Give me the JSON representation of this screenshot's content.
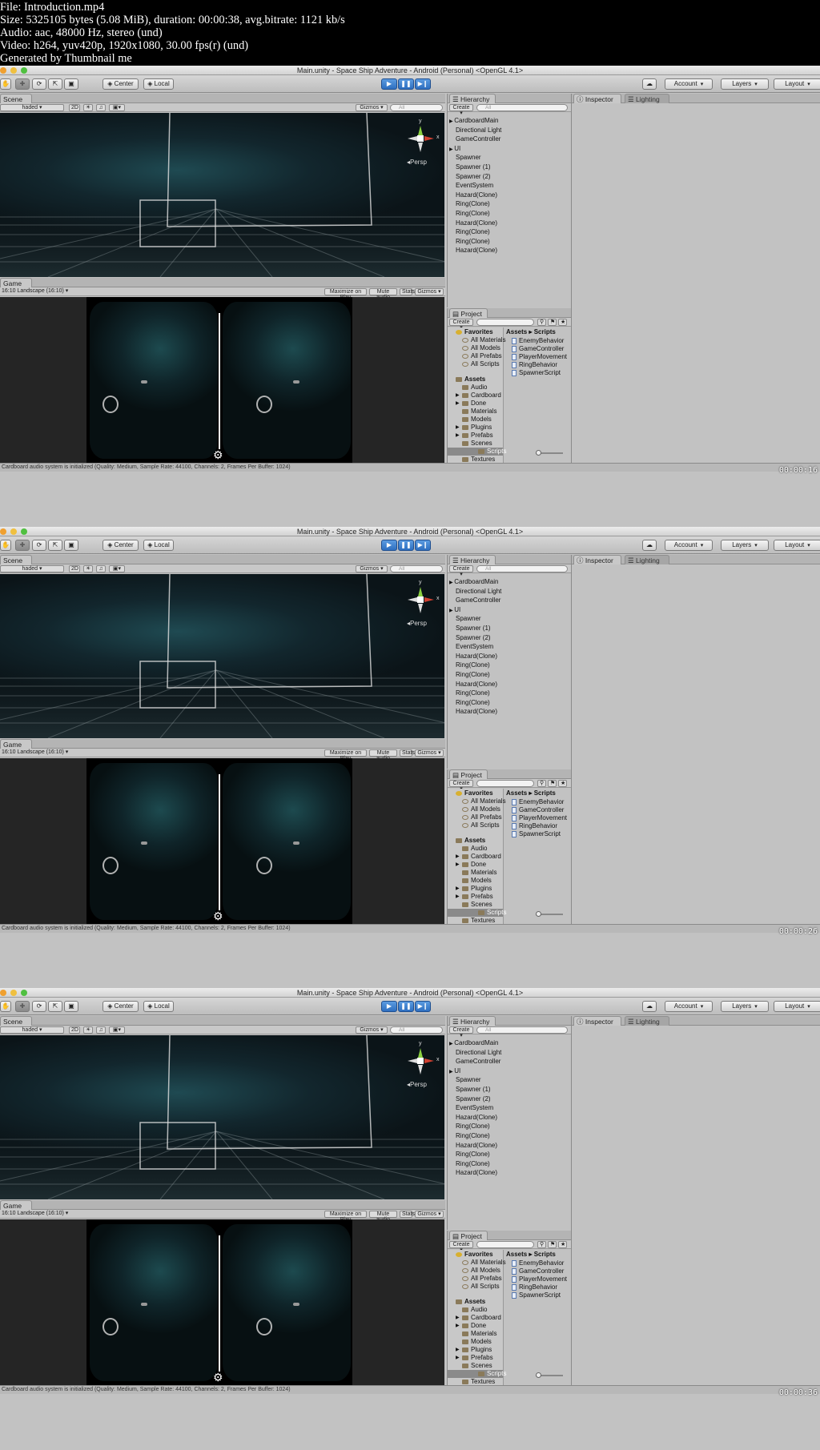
{
  "meta": {
    "file": "File: Introduction.mp4",
    "size": "Size: 5325105 bytes (5.08 MiB), duration: 00:00:38, avg.bitrate: 1121 kb/s",
    "audio": "Audio: aac, 48000 Hz, stereo (und)",
    "video": "Video: h264, yuv420p, 1920x1080, 30.00 fps(r) (und)",
    "generator": "Generated by Thumbnail me"
  },
  "window_title": "Main.unity - Space Ship Adventure - Android (Personal) <OpenGL 4.1>",
  "toolbar": {
    "center": "Center",
    "local": "Local",
    "account": "Account",
    "layers": "Layers",
    "layout": "Layout"
  },
  "scene": {
    "tab": "Scene",
    "shading": "haded",
    "mode_2d": "2D",
    "gizmos": "Gizmos",
    "search_placeholder": "All",
    "persp": "Persp",
    "axis_x": "x",
    "axis_y": "y"
  },
  "game": {
    "tab": "Game",
    "aspect": "16:10 Landscape (16:10)",
    "maximize": "Maximize on Play",
    "mute": "Mute audio",
    "stats": "Stats",
    "gizmos": "Gizmos"
  },
  "hierarchy": {
    "tab": "Hierarchy",
    "create": "Create",
    "search_placeholder": "All",
    "items": [
      "CardboardMain",
      "Directional Light",
      "GameController",
      "UI",
      "Spawner",
      "Spawner (1)",
      "Spawner (2)",
      "EventSystem",
      "Hazard(Clone)",
      "Ring(Clone)",
      "Ring(Clone)",
      "Hazard(Clone)",
      "Ring(Clone)",
      "Ring(Clone)",
      "Hazard(Clone)"
    ]
  },
  "project": {
    "tab": "Project",
    "create": "Create",
    "favorites_label": "Favorites",
    "favorites": [
      "All Materials",
      "All Models",
      "All Prefabs",
      "All Scripts"
    ],
    "assets_label": "Assets",
    "assets": [
      "Audio",
      "Cardboard",
      "Done",
      "Materials",
      "Models",
      "Plugins",
      "Prefabs",
      "Scenes",
      "Scripts",
      "Textures"
    ],
    "breadcrumb": "Assets ▸ Scripts",
    "scripts": [
      "EnemyBehavior",
      "GameController",
      "PlayerMovement",
      "RingBehavior",
      "SpawnerScript"
    ]
  },
  "inspector": {
    "tab": "Inspector",
    "lighting": "Lighting"
  },
  "status_text": "Cardboard audio system is initialized (Quality: Medium, Sample Rate: 44100, Channels: 2, Frames Per Buffer: 1024)",
  "timestamps": [
    "00:00:16",
    "00:00:26",
    "00:00:36"
  ]
}
